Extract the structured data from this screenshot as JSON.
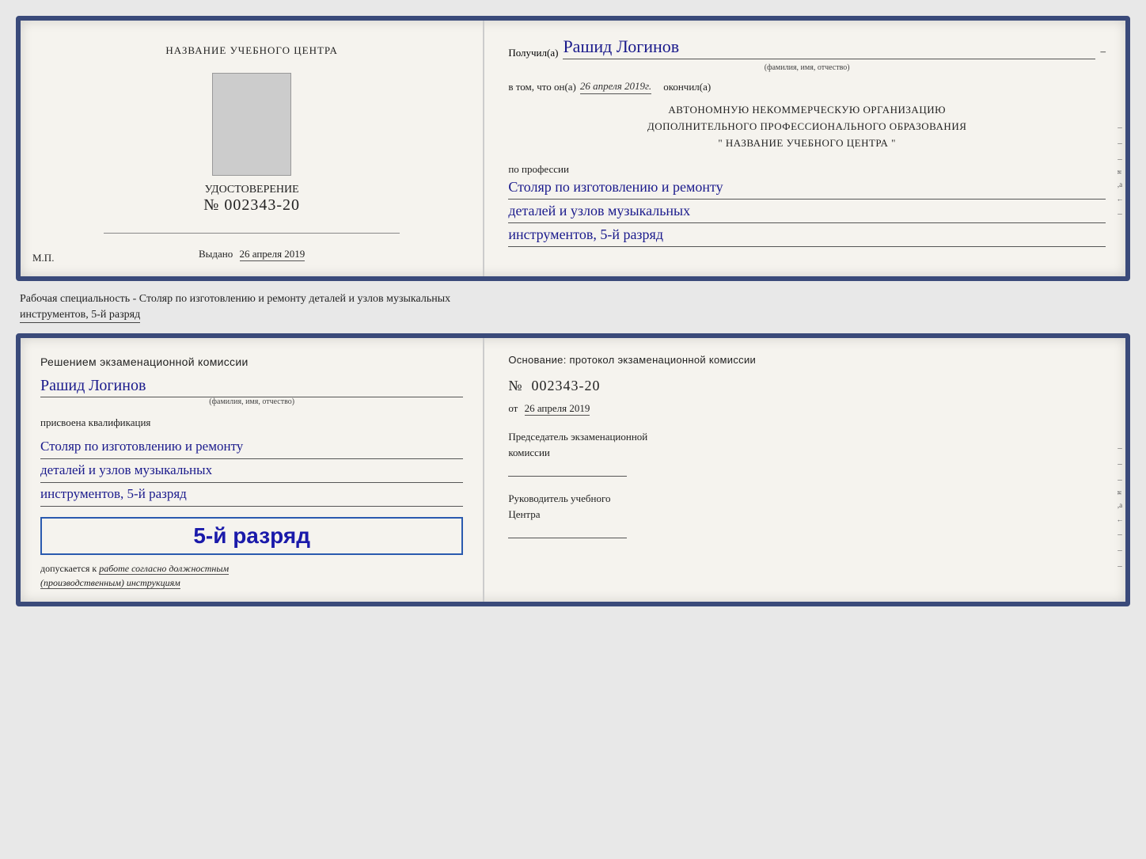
{
  "top_card": {
    "left": {
      "center_title": "НАЗВАНИЕ УЧЕБНОГО ЦЕНТРА",
      "cert_type": "УДОСТОВЕРЕНИЕ",
      "cert_number_prefix": "№",
      "cert_number": "002343-20",
      "issued_label": "Выдано",
      "issued_date": "26 апреля 2019",
      "mp_label": "М.П."
    },
    "right": {
      "recipient_prefix": "Получил(а)",
      "recipient_name": "Рашид Логинов",
      "recipient_subtext": "(фамилия, имя, отчество)",
      "date_prefix": "в том, что он(а)",
      "date_value": "26 апреля 2019г.",
      "date_suffix": "окончил(а)",
      "org_line1": "АВТОНОМНУЮ НЕКОММЕРЧЕСКУЮ ОРГАНИЗАЦИЮ",
      "org_line2": "ДОПОЛНИТЕЛЬНОГО ПРОФЕССИОНАЛЬНОГО ОБРАЗОВАНИЯ",
      "org_line3": "\"  НАЗВАНИЕ УЧЕБНОГО ЦЕНТРА  \"",
      "profession_prefix": "по профессии",
      "profession_line1": "Столяр по изготовлению и ремонту",
      "profession_line2": "деталей и узлов музыкальных",
      "profession_line3": "инструментов, 5-й разряд",
      "side_labels": [
        "–",
        "–",
        "–",
        "и",
        ",а",
        "←",
        "–"
      ]
    }
  },
  "specialty_label": "Рабочая специальность - Столяр по изготовлению и ремонту деталей и узлов музыкальных",
  "specialty_label2": "инструментов, 5-й разряд",
  "bottom_card": {
    "left": {
      "commission_line1": "Решением  экзаменационной  комиссии",
      "person_name": "Рашид Логинов",
      "person_subtext": "(фамилия, имя, отчество)",
      "qualification_label": "присвоена квалификация",
      "qual_line1": "Столяр по изготовлению и ремонту",
      "qual_line2": "деталей и узлов музыкальных",
      "qual_line3": "инструментов, 5-й разряд",
      "big_rank": "5-й разряд",
      "allowed_prefix": "допускается к",
      "allowed_italic": "работе согласно должностным",
      "allowed_italic2": "(производственным) инструкциям"
    },
    "right": {
      "basis_label": "Основание:  протокол  экзаменационной  комиссии",
      "protocol_number_prefix": "№",
      "protocol_number": "002343-20",
      "protocol_date_prefix": "от",
      "protocol_date": "26 апреля 2019",
      "chairman_label1": "Председатель экзаменационной",
      "chairman_label2": "комиссии",
      "director_label1": "Руководитель учебного",
      "director_label2": "Центра",
      "side_labels": [
        "–",
        "–",
        "–",
        "и",
        ",а",
        "←",
        "–",
        "–",
        "–"
      ]
    }
  }
}
